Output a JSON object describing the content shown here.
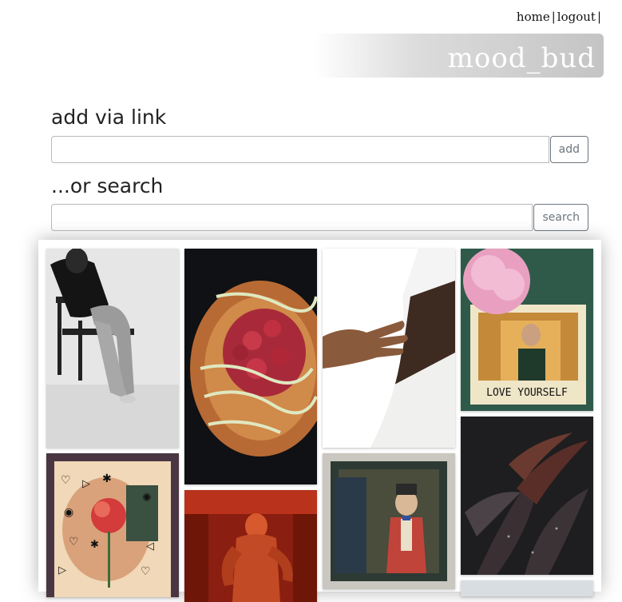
{
  "nav": {
    "home_label": "home",
    "separator": "|",
    "logout_label": "logout"
  },
  "brand": {
    "title": "mood_bud"
  },
  "add_section": {
    "heading": "add via link",
    "input_value": "",
    "button_label": "add"
  },
  "search_section": {
    "heading": "...or search",
    "input_value": "",
    "button_label": "search"
  },
  "images": [
    {
      "label": "person-sitting-chair-photo"
    },
    {
      "label": "raspberry-pastry-photo"
    },
    {
      "label": "hand-over-face-photo"
    },
    {
      "label": "love-yourself-collage-photo",
      "caption": "LOVE YOURSELF"
    },
    {
      "label": "heart-doodle-flower-photo"
    },
    {
      "label": "red-statue-photo"
    },
    {
      "label": "vintage-child-portrait-photo"
    },
    {
      "label": "dark-plant-leaves-photo"
    }
  ]
}
